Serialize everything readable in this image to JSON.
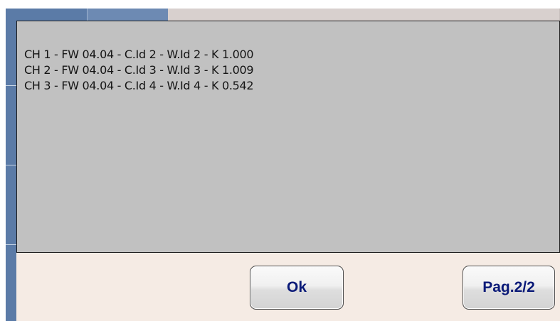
{
  "dialog": {
    "info_lines": [
      "CH 1 - FW 04.04 - C.Id 2 - W.Id 2 - K 1.000",
      "CH 2 - FW 04.04 - C.Id 3 - W.Id 3 - K 1.009",
      "CH 3 - FW 04.04 - C.Id 4 - W.Id 4 - K 0.542"
    ],
    "ok_label": "Ok",
    "page_label": "Pag.2/2"
  },
  "colors": {
    "panel_bg": "#c1c1c1",
    "dialog_bg": "#f5ebe4",
    "button_text": "#0a1a78",
    "app_accent": "#5b7ba7"
  }
}
